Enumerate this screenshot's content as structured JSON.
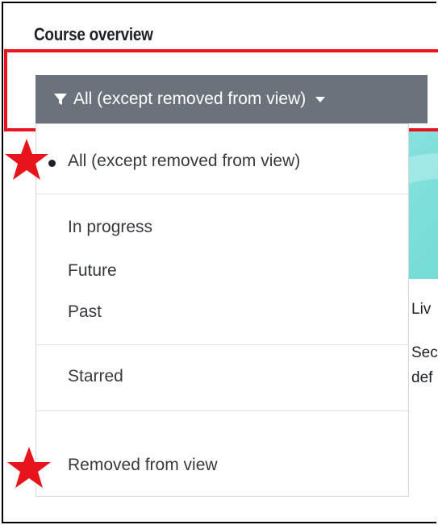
{
  "section": {
    "title": "Course overview"
  },
  "filter": {
    "button_label": "All (except removed from view)",
    "options": [
      {
        "label": "All (except removed from view)",
        "selected": true
      },
      {
        "label": "In progress",
        "selected": false
      },
      {
        "label": "Future",
        "selected": false
      },
      {
        "label": "Past",
        "selected": false
      },
      {
        "label": "Starred",
        "selected": false
      },
      {
        "label": "Removed from view",
        "selected": false
      }
    ]
  },
  "course_card": {
    "line1": "Liv",
    "line2": "Sec",
    "line3": "def"
  },
  "annotations": {
    "highlight_color": "#e8141b",
    "star_color": "#e8141b"
  },
  "colors": {
    "button_bg": "#6a737b",
    "card_image": "#8fe4df"
  }
}
